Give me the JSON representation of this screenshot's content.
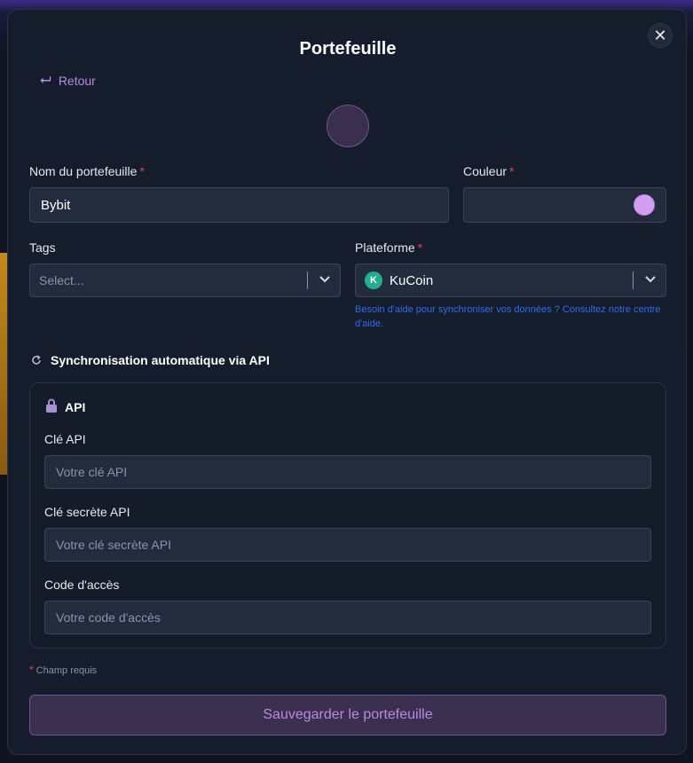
{
  "modal": {
    "title": "Portefeuille",
    "back_label": "Retour",
    "close_icon": "close-icon"
  },
  "form": {
    "name_label": "Nom du portefeuille",
    "name_value": "Bybit",
    "color_label": "Couleur",
    "color_value": "#d49cf2",
    "tags_label": "Tags",
    "tags_placeholder": "Select...",
    "platform_label": "Plateforme",
    "platform_value": "KuCoin",
    "platform_help": "Besoin d'aide pour synchroniser vos données ? Consultez notre centre d'aide.",
    "required_marker": "*"
  },
  "sync": {
    "title": "Synchronisation automatique via API",
    "api_title": "API",
    "api_key_label": "Clé API",
    "api_key_placeholder": "Votre clé API",
    "api_secret_label": "Clé secrète API",
    "api_secret_placeholder": "Votre clé secrète API",
    "passcode_label": "Code d'accès",
    "passcode_placeholder": "Votre code d'accès"
  },
  "footer": {
    "required_note": "Champ requis",
    "save_label": "Sauvegarder le portefeuille"
  },
  "colors": {
    "accent": "#b88ce0",
    "required": "#e0454d",
    "help_link": "#2f6cf0",
    "kucoin": "#24ae8f"
  }
}
